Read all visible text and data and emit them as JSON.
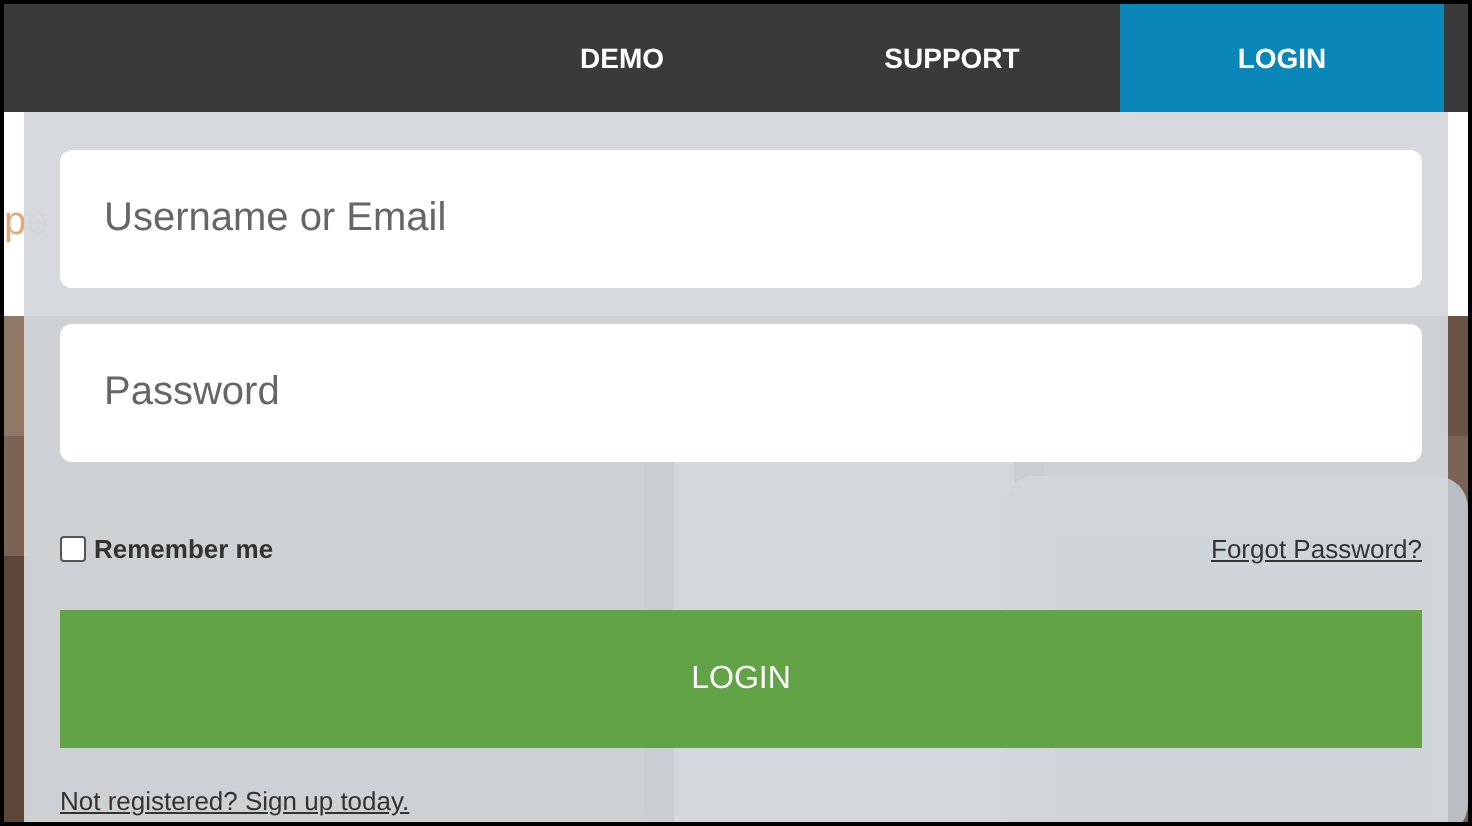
{
  "nav": {
    "items": [
      {
        "label": "DEMO",
        "selected": false
      },
      {
        "label": "SUPPORT",
        "selected": false
      },
      {
        "label": "LOGIN",
        "selected": true
      }
    ]
  },
  "hero": {
    "text": "pe"
  },
  "login_form": {
    "username": {
      "placeholder": "Username or Email"
    },
    "password": {
      "placeholder": "Password"
    },
    "remember_me": {
      "label": "Remember me",
      "checked": false
    },
    "forgot_link": "Forgot Password?",
    "submit": "LOGIN",
    "signup_link": "Not registered? Sign up today."
  }
}
